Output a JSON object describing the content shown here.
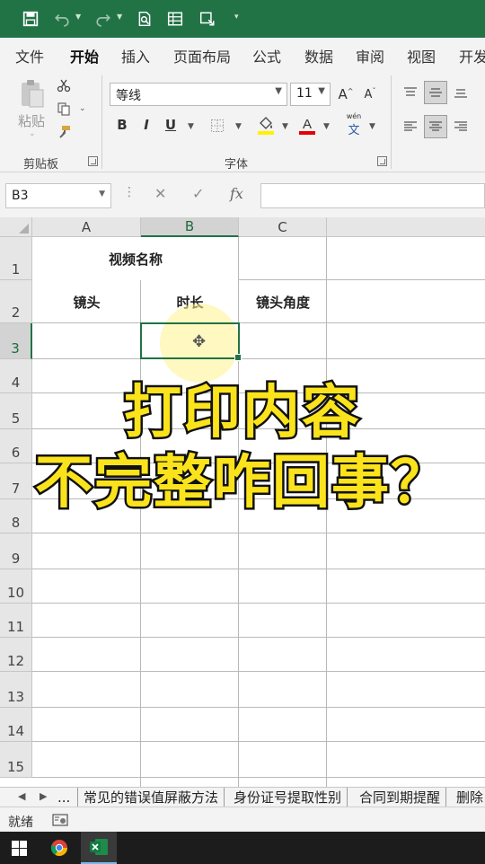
{
  "tabs": [
    "文件",
    "开始",
    "插入",
    "页面布局",
    "公式",
    "数据",
    "审阅",
    "视图",
    "开发"
  ],
  "active_tab": "开始",
  "ribbon": {
    "clipboard_label": "剪贴板",
    "paste_label": "粘贴",
    "font_group_label": "字体",
    "font_name": "等线",
    "font_size": "11",
    "bold": "B",
    "italic": "I",
    "underline": "U",
    "grow": "A",
    "shrink": "A",
    "phonetic_top": "wén",
    "phonetic_bottom": "文"
  },
  "colors": {
    "accent": "#217346",
    "highlight": "#fff200",
    "font_color": "#e60000",
    "overlay_fill": "#fbe31c"
  },
  "formula_bar": {
    "cell_ref": "B3",
    "fx": "fx",
    "value": ""
  },
  "columns": [
    "A",
    "B",
    "C"
  ],
  "rows": [
    "1",
    "2",
    "3",
    "4",
    "5",
    "6",
    "7",
    "8",
    "9",
    "10",
    "11",
    "12",
    "13",
    "14",
    "15"
  ],
  "cells": {
    "a1": "视频名称",
    "a2": "镜头",
    "b2": "时长",
    "c2": "镜头角度"
  },
  "overlay": {
    "line1": "打印内容",
    "line2": "不完整咋回事？"
  },
  "sheet_tabs": [
    "...",
    "常见的错误值屏蔽方法",
    "身份证号提取性别",
    "合同到期提醒",
    "删除"
  ],
  "status": {
    "ready": "就绪"
  }
}
